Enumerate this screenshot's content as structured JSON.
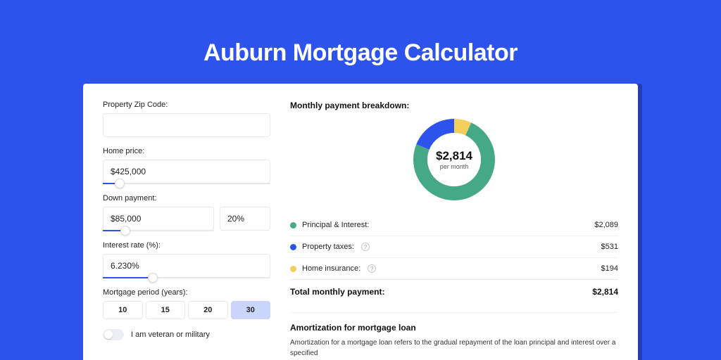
{
  "title": "Auburn Mortgage Calculator",
  "form": {
    "zip_label": "Property Zip Code:",
    "zip_value": "",
    "home_price_label": "Home price:",
    "home_price_value": "$425,000",
    "home_price_slider_pct": 10,
    "down_payment_label": "Down payment:",
    "down_payment_value": "$85,000",
    "down_payment_pct_value": "20%",
    "down_payment_slider_pct": 20,
    "interest_label": "Interest rate (%):",
    "interest_value": "6.230%",
    "interest_slider_pct": 30,
    "period_label": "Mortgage period (years):",
    "periods": [
      "10",
      "15",
      "20",
      "30"
    ],
    "period_active_index": 3,
    "veteran_label": "I am veteran or military",
    "veteran_on": false
  },
  "breakdown": {
    "title": "Monthly payment breakdown:",
    "monthly_total": "$2,814",
    "monthly_sub": "per month",
    "items": [
      {
        "label": "Principal & Interest:",
        "value": "$2,089",
        "valueNum": 2089,
        "color": "#45a887",
        "help": false
      },
      {
        "label": "Property taxes:",
        "value": "$531",
        "valueNum": 531,
        "color": "#2d53ec",
        "help": true
      },
      {
        "label": "Home insurance:",
        "value": "$194",
        "valueNum": 194,
        "color": "#f2cf5b",
        "help": true
      }
    ],
    "total_label": "Total monthly payment:",
    "total_value": "$2,814"
  },
  "amort": {
    "title": "Amortization for mortgage loan",
    "text": "Amortization for a mortgage loan refers to the gradual repayment of the loan principal and interest over a specified"
  },
  "chart_data": {
    "type": "pie",
    "title": "Monthly payment breakdown",
    "series": [
      {
        "name": "Principal & Interest",
        "value": 2089,
        "color": "#45a887"
      },
      {
        "name": "Property taxes",
        "value": 531,
        "color": "#2d53ec"
      },
      {
        "name": "Home insurance",
        "value": 194,
        "color": "#f2cf5b"
      }
    ],
    "total": 2814,
    "center_label": "$2,814",
    "center_sub": "per month"
  }
}
